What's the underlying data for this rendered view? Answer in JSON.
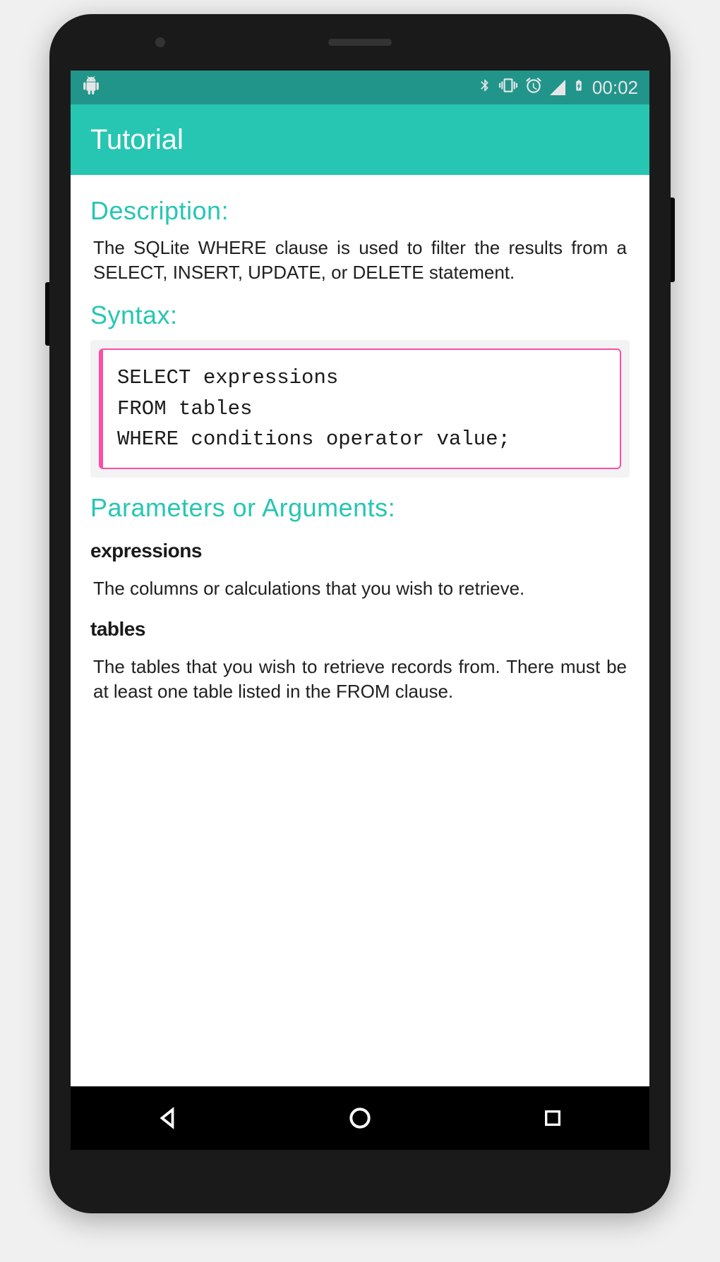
{
  "status_bar": {
    "time": "00:02"
  },
  "app_bar": {
    "title": "Tutorial"
  },
  "content": {
    "description_heading": "Description:",
    "description_text": "The SQLite WHERE clause is used to filter the results from a SELECT, INSERT, UPDATE, or DELETE statement.",
    "syntax_heading": "Syntax:",
    "syntax_code": "SELECT expressions\nFROM tables\nWHERE conditions operator value;",
    "params_heading": "Parameters or Arguments:",
    "params": [
      {
        "name": "expressions",
        "desc": "The columns or calculations that you wish to retrieve."
      },
      {
        "name": "tables",
        "desc": "The tables that you wish to retrieve records from. There must be at least one table listed in the FROM clause."
      }
    ]
  }
}
